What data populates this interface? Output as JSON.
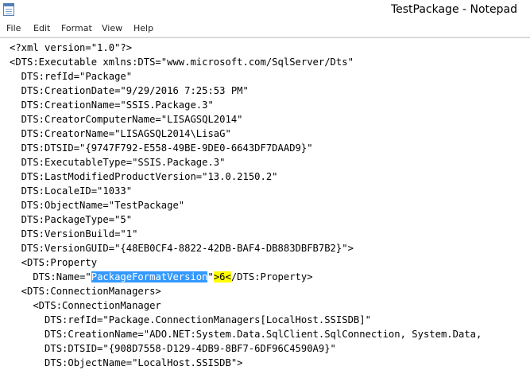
{
  "window": {
    "title": "TestPackage - Notepad",
    "icon": "notepad-icon"
  },
  "menu": {
    "file": "File",
    "edit": "Edit",
    "format": "Format",
    "view": "View",
    "help": "Help"
  },
  "editor": {
    "lines": [
      "<?xml version=\"1.0\"?>",
      "<DTS:Executable xmlns:DTS=\"www.microsoft.com/SqlServer/Dts\"",
      "  DTS:refId=\"Package\"",
      "  DTS:CreationDate=\"9/29/2016 7:25:53 PM\"",
      "  DTS:CreationName=\"SSIS.Package.3\"",
      "  DTS:CreatorComputerName=\"LISAGSQL2014\"",
      "  DTS:CreatorName=\"LISAGSQL2014\\LisaG\"",
      "  DTS:DTSID=\"{9747F792-E558-49BE-9DE0-6643DF7DAAD9}\"",
      "  DTS:ExecutableType=\"SSIS.Package.3\"",
      "  DTS:LastModifiedProductVersion=\"13.0.2150.2\"",
      "  DTS:LocaleID=\"1033\"",
      "  DTS:ObjectName=\"TestPackage\"",
      "  DTS:PackageType=\"5\"",
      "  DTS:VersionBuild=\"1\"",
      "  DTS:VersionGUID=\"{48EB0CF4-8822-42DB-BAF4-DB883DBFB7B2}\">",
      "  <DTS:Property",
      {
        "pre": "    DTS:Name=\"",
        "sel": "PackageFormatVersion",
        "mid": "\"",
        "hl": ">6<",
        "post": "/DTS:Property>"
      },
      "  <DTS:ConnectionManagers>",
      "    <DTS:ConnectionManager",
      "      DTS:refId=\"Package.ConnectionManagers[LocalHost.SSISDB]\"",
      "      DTS:CreationName=\"ADO.NET:System.Data.SqlClient.SqlConnection, System.Data,",
      "      DTS:DTSID=\"{908D7558-D129-4DB9-8BF7-6DF96C4590A9}\"",
      "      DTS:ObjectName=\"LocalHost.SSISDB\">"
    ]
  }
}
